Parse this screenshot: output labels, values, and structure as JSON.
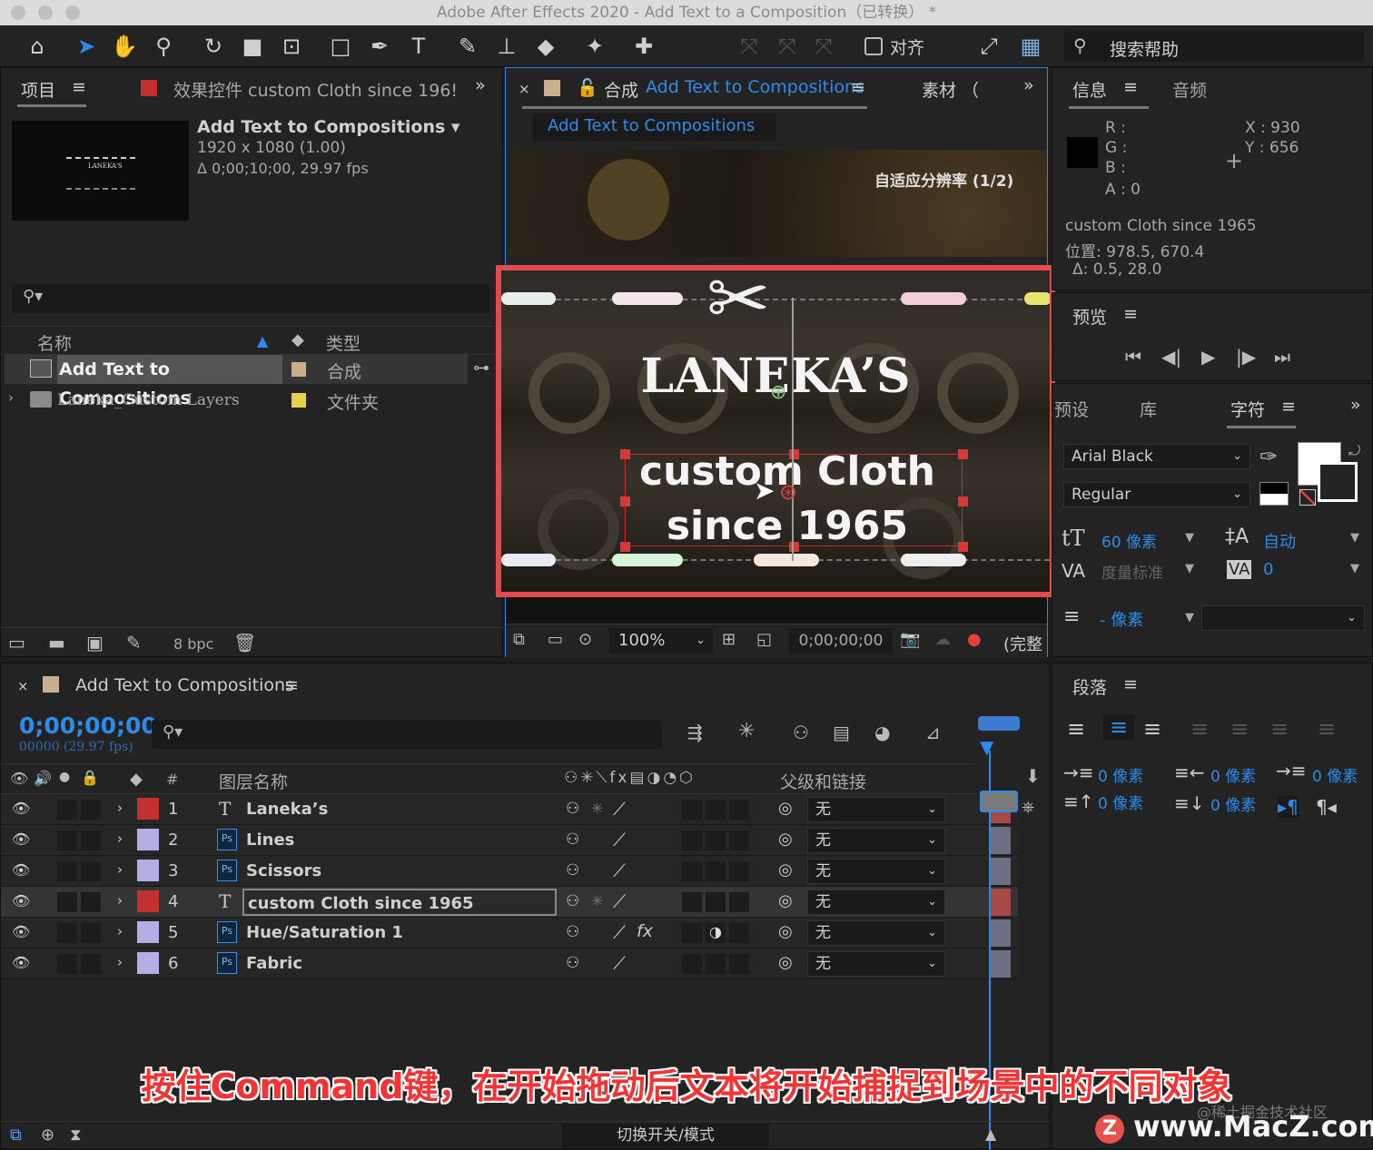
{
  "app": {
    "title": "Adobe After Effects 2020 - Add Text to a Composition（已转换）  *"
  },
  "toolbar": {
    "align_label": "对齐",
    "search_help": "搜索帮助"
  },
  "project_panel": {
    "tab": "项目",
    "effects_tab": "效果控件 custom Cloth  since 196!",
    "comp_name": "Add Text to Compositions ▾",
    "comp_size": "1920 x 1080 (1.00)",
    "comp_duration": "Δ 0;00;10;00, 29.97 fps",
    "col_name": "名称",
    "col_type": "类型",
    "items": [
      {
        "name": "Add Text to Compositions",
        "type": "合成",
        "color": "#c9b08c"
      },
      {
        "name": "Laneka_Custom Layers",
        "type": "文件夹",
        "color": "#e5d24b"
      }
    ],
    "bpc": "8 bpc"
  },
  "comp_panel": {
    "tab_prefix": "合成",
    "tab_name": "Add Text to Compositions",
    "footage_tab": "素材 （",
    "breadcrumb": "Add Text to Compositions",
    "resolution": "自适应分辨率 (1/2)",
    "canvas": {
      "title": "LANEKA’S",
      "line1": "custom Cloth",
      "line2": "since 1965"
    },
    "zoom": "100%",
    "timecode": "0;00;00;00",
    "quality": "(完整"
  },
  "info_panel": {
    "tab": "信息",
    "audio_tab": "音频",
    "r": "R :",
    "g": "G :",
    "b": "B :",
    "a": "A :  0",
    "x": "X : 930",
    "y": "Y :  656",
    "layer": "custom Cloth  since 1965",
    "position": "位置: 978.5, 670.4",
    "delta": "Δ: 0.5, 28.0"
  },
  "preview_panel": {
    "title": "预览"
  },
  "character_panel": {
    "tab_presets": "预设",
    "tab_library": "库",
    "tab_character": "字符",
    "font": "Arial Black",
    "style": "Regular",
    "size": "60 像素",
    "leading": "自动",
    "kerning": "度量标准",
    "tracking": "0",
    "stroke": "- 像素"
  },
  "paragraph_panel": {
    "title": "段落",
    "indent1": "0 像素",
    "indent2": "0 像素",
    "indent3": "0 像素",
    "space1": "0 像素",
    "space2": "0 像素"
  },
  "timeline": {
    "tab": "Add Text to Compositions",
    "timecode": "0;00;00;00",
    "frames": "00000 (29.97 fps)",
    "col_num": "#",
    "col_name": "图层名称",
    "col_parent": "父级和链接",
    "toggle": "切换开关/模式",
    "layers": [
      {
        "num": "1",
        "name": "Laneka’s",
        "type": "T",
        "color": "#c23030",
        "parent": "无"
      },
      {
        "num": "2",
        "name": "Lines",
        "type": "Ps",
        "color": "#b3aee6",
        "parent": "无"
      },
      {
        "num": "3",
        "name": "Scissors",
        "type": "Ps",
        "color": "#b3aee6",
        "parent": "无"
      },
      {
        "num": "4",
        "name": "custom Cloth  since 1965",
        "type": "T",
        "color": "#c23030",
        "parent": "无"
      },
      {
        "num": "5",
        "name": "Hue/Saturation 1",
        "type": "Ps",
        "color": "#b3aee6",
        "parent": "无"
      },
      {
        "num": "6",
        "name": "Fabric",
        "type": "Ps",
        "color": "#b3aee6",
        "parent": "无"
      }
    ]
  },
  "subtitle": "按住Command键，在开始拖动后文本将开始捕捉到场景中的不同对象",
  "watermark": {
    "site": "www.MacZ.com",
    "credit": "@稀土掘金技术社区",
    "logo": "Z"
  }
}
